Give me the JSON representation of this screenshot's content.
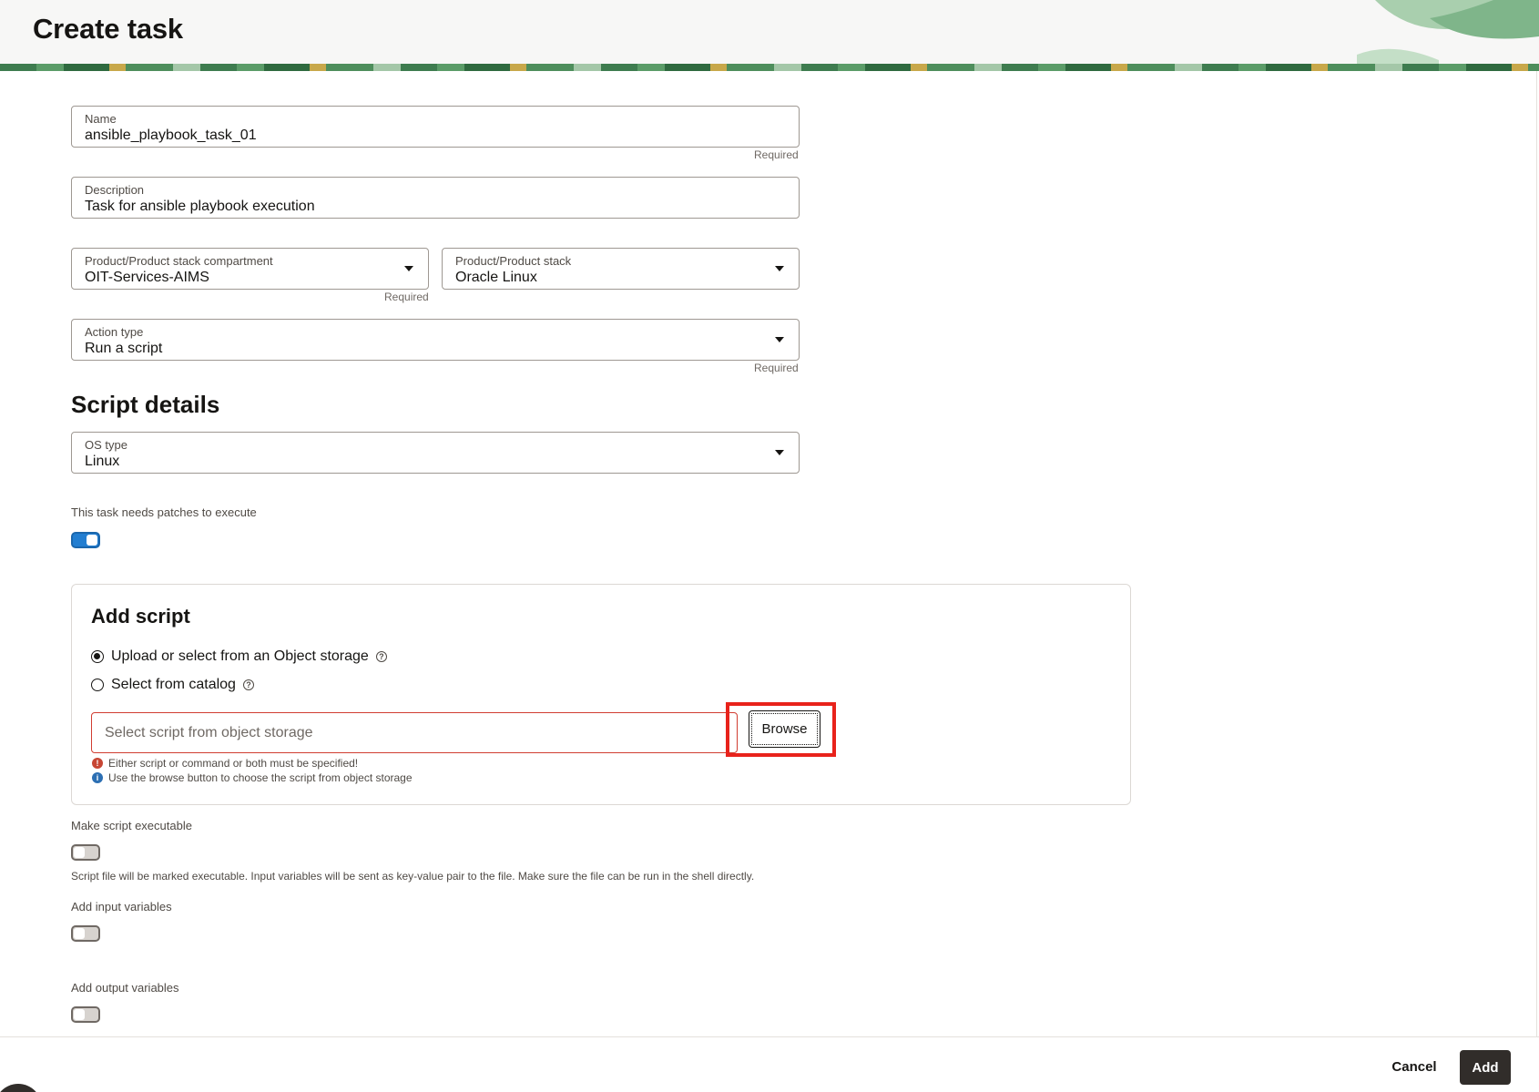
{
  "header": {
    "title": "Create task"
  },
  "form": {
    "name": {
      "label": "Name",
      "value": "ansible_playbook_task_01",
      "hint": "Required"
    },
    "description": {
      "label": "Description",
      "value": "Task for ansible playbook execution"
    },
    "compartment": {
      "label": "Product/Product stack compartment",
      "value": "OIT-Services-AIMS",
      "hint": "Required"
    },
    "product_stack": {
      "label": "Product/Product stack",
      "value": "Oracle Linux"
    },
    "action_type": {
      "label": "Action type",
      "value": "Run a script",
      "hint": "Required"
    }
  },
  "script_details": {
    "title": "Script details",
    "os_type": {
      "label": "OS type",
      "value": "Linux"
    },
    "patches_toggle": {
      "label": "This task needs patches to execute",
      "on": true
    }
  },
  "add_script": {
    "title": "Add script",
    "options": [
      {
        "label": "Upload or select from an Object storage",
        "selected": true
      },
      {
        "label": "Select from catalog",
        "selected": false
      }
    ],
    "script_input": {
      "placeholder": "Select script from object storage",
      "value": ""
    },
    "browse_label": "Browse",
    "error_message": "Either script or command or both must be specified!",
    "info_message": "Use the browse button to choose the script from object storage"
  },
  "options": {
    "make_executable": {
      "label": "Make script executable",
      "on": false,
      "description": "Script file will be marked executable. Input variables will be sent as key-value pair to the file. Make sure the file can be run in the shell directly."
    },
    "input_variables": {
      "label": "Add input variables",
      "on": false
    },
    "output_variables": {
      "label": "Add output variables",
      "on": false
    }
  },
  "footer": {
    "cancel_label": "Cancel",
    "add_label": "Add"
  },
  "colors": {
    "primary_button": "#312d2a",
    "toggle_on": "#227ed1",
    "error_border": "#d13d31",
    "highlight": "#e8221b"
  }
}
